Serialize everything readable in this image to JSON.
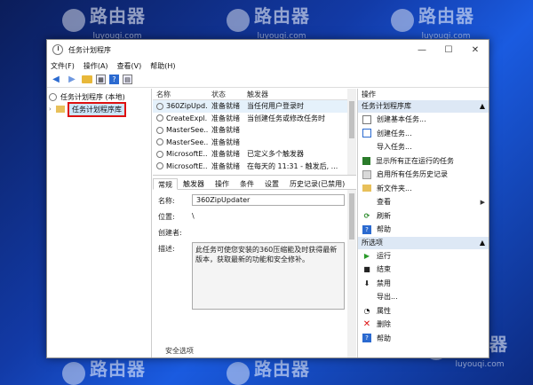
{
  "watermark": {
    "brand": "路由器",
    "url": "luyouqi.com"
  },
  "window": {
    "title": "任务计划程序",
    "controls": {
      "minimize": "—",
      "maximize": "☐",
      "close": "✕"
    }
  },
  "menu": [
    "文件(F)",
    "操作(A)",
    "查看(V)",
    "帮助(H)"
  ],
  "tree": {
    "root": "任务计划程序 (本地)",
    "child": "任务计划程序库"
  },
  "tasks": {
    "columns": [
      "名称",
      "状态",
      "触发器"
    ],
    "rows": [
      {
        "name": "360ZipUpd...",
        "status": "准备就绪",
        "trigger": "当任何用户登录时"
      },
      {
        "name": "CreateExpl...",
        "status": "准备就绪",
        "trigger": "当创建任务或修改任务时"
      },
      {
        "name": "MasterSee...",
        "status": "准备就绪",
        "trigger": ""
      },
      {
        "name": "MasterSee...",
        "status": "准备就绪",
        "trigger": ""
      },
      {
        "name": "MicrosoftE...",
        "status": "准备就绪",
        "trigger": "已定义多个触发器"
      },
      {
        "name": "MicrosoftE...",
        "status": "准备就绪",
        "trigger": "在每天的 11:31 - 触发后, ..."
      }
    ]
  },
  "tabs": [
    "常规",
    "触发器",
    "操作",
    "条件",
    "设置",
    "历史记录(已禁用)"
  ],
  "detail": {
    "name_label": "名称:",
    "name_value": "360ZipUpdater",
    "location_label": "位置:",
    "location_value": "\\",
    "author_label": "创建者:",
    "author_value": "",
    "desc_label": "描述:",
    "desc_value": "此任务可使您安装的360压缩能及时获得最新版本，获取最新的功能和安全修补。",
    "security_label": "安全选项"
  },
  "actions": {
    "title": "操作",
    "section1": "任务计划程序库",
    "items1": [
      "创建基本任务...",
      "创建任务...",
      "导入任务...",
      "显示所有正在运行的任务",
      "启用所有任务历史记录",
      "新文件夹...",
      "查看",
      "刷新",
      "帮助"
    ],
    "section2": "所选项",
    "items2": [
      "运行",
      "结束",
      "禁用",
      "导出...",
      "属性",
      "删除",
      "帮助"
    ]
  }
}
